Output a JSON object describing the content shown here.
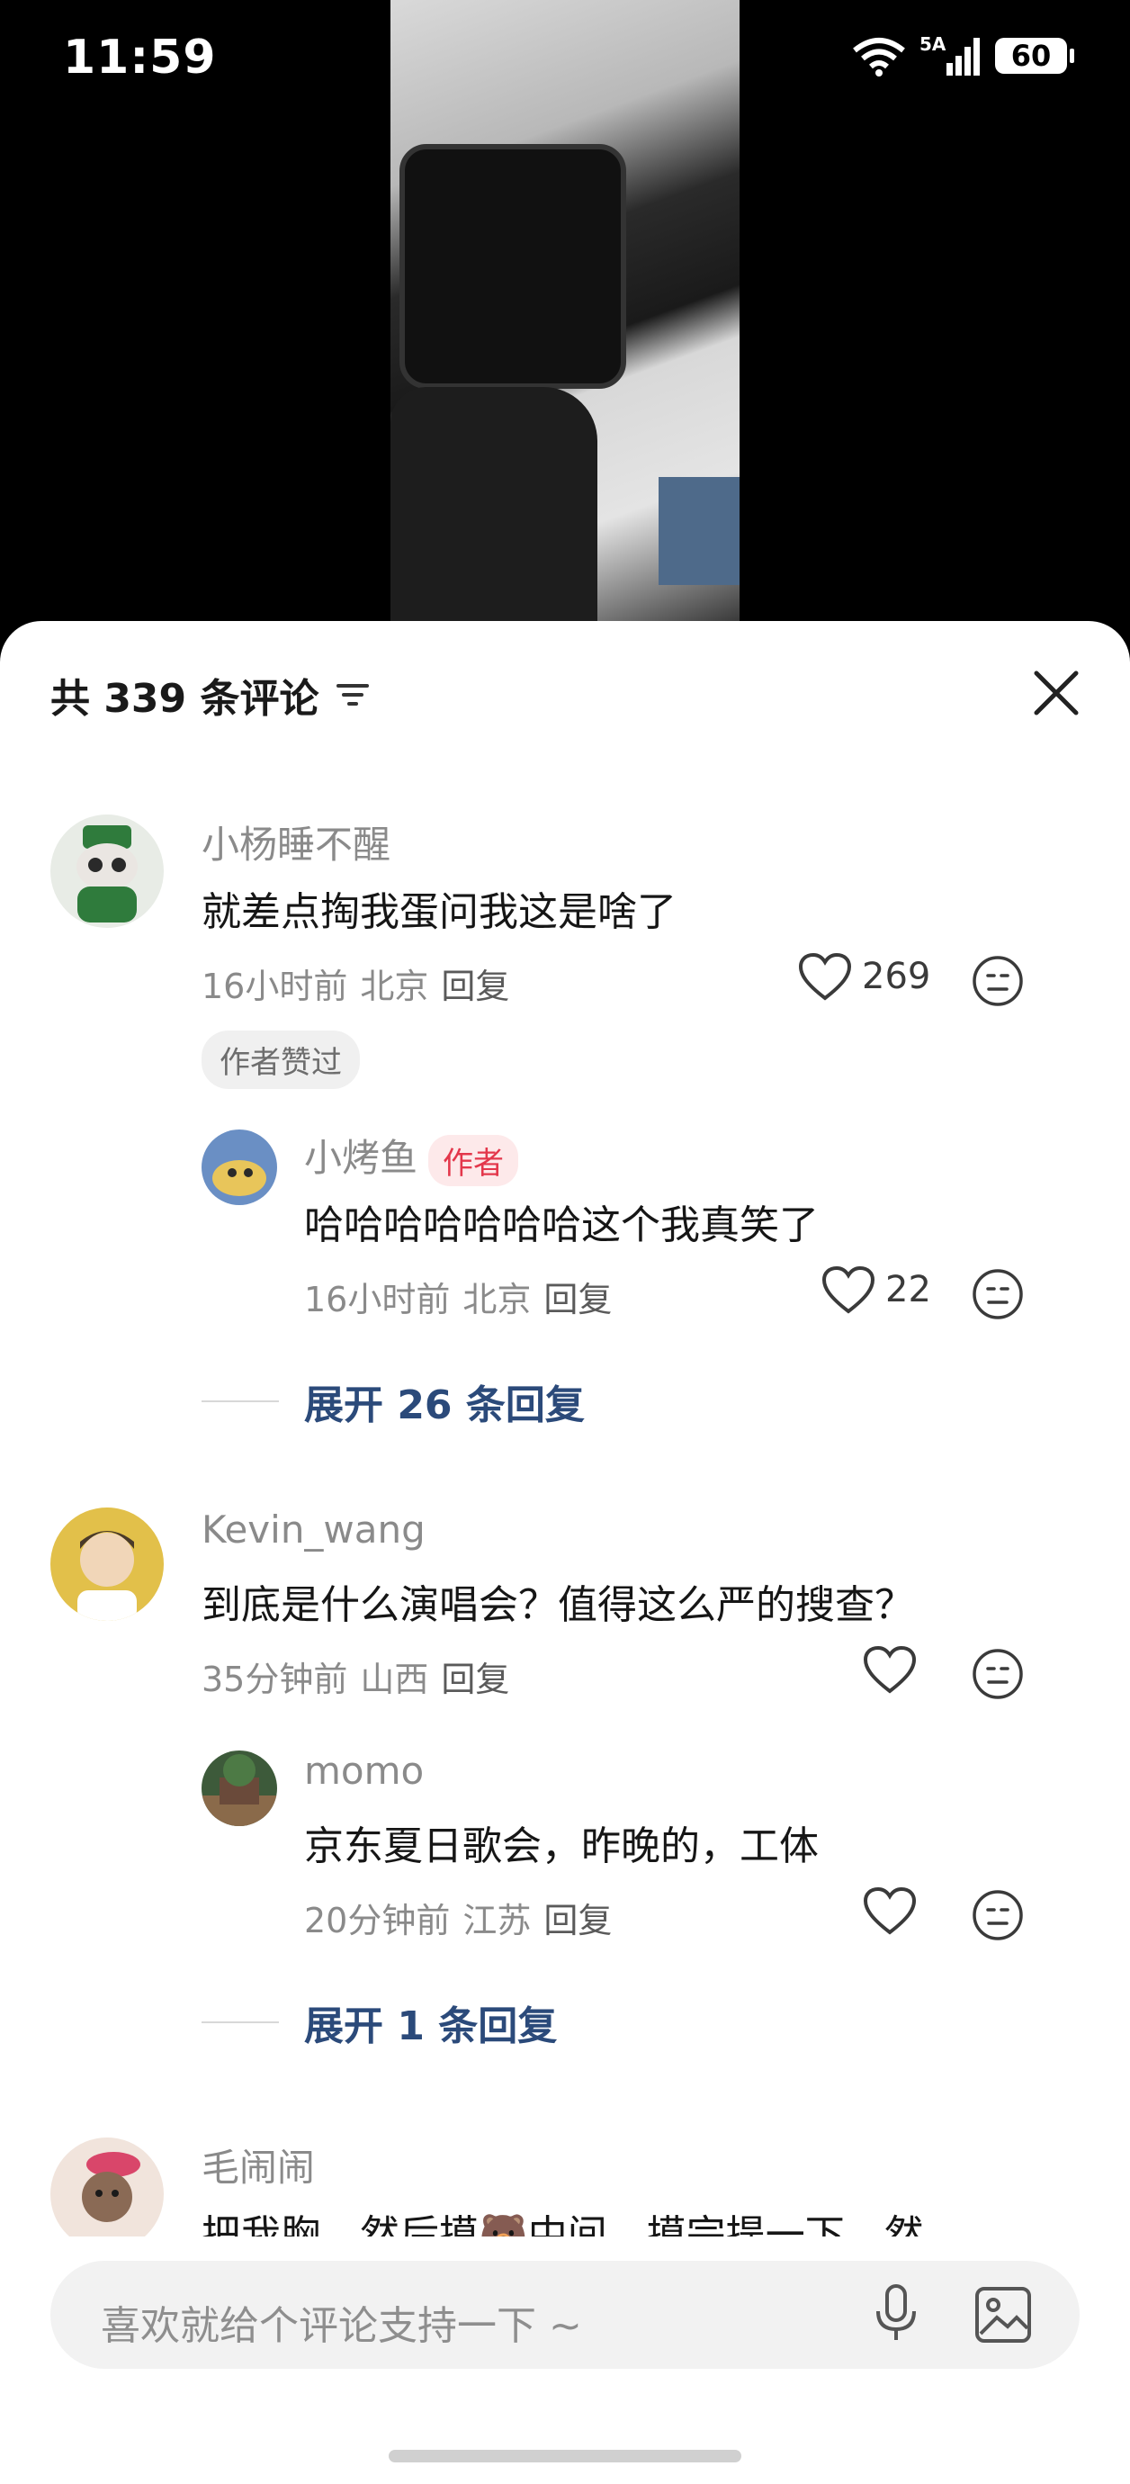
{
  "status": {
    "time": "11:59",
    "battery": "60",
    "signal": "5A",
    "wifi": "6"
  },
  "header": {
    "title": "共 339 条评论"
  },
  "comments": [
    {
      "name": "小杨睡不醒",
      "text": "就差点掏我蛋问我这是啥了",
      "time": "16小时前",
      "location": "北京",
      "reply": "回复",
      "likes": "269",
      "badge": "作者赞过",
      "sub": {
        "name": "小烤鱼",
        "tag": "作者",
        "text": "哈哈哈哈哈哈哈这个我真笑了",
        "time": "16小时前",
        "location": "北京",
        "reply": "回复",
        "likes": "22"
      },
      "expand": "展开 26 条回复"
    },
    {
      "name": "Kevin_wang",
      "text": "到底是什么演唱会？值得这么严的搜查？",
      "time": "35分钟前",
      "location": "山西",
      "reply": "回复",
      "sub": {
        "name": "momo",
        "text": "京东夏日歌会，昨晚的，工体",
        "time": "20分钟前",
        "location": "江苏",
        "reply": "回复"
      },
      "expand": "展开 1 条回复"
    },
    {
      "name": "毛闹闹",
      "text": "把我胸，然后摸🐻中间，摸完提一下，然"
    }
  ],
  "input": {
    "placeholder": "喜欢就给个评论支持一下 ~"
  }
}
